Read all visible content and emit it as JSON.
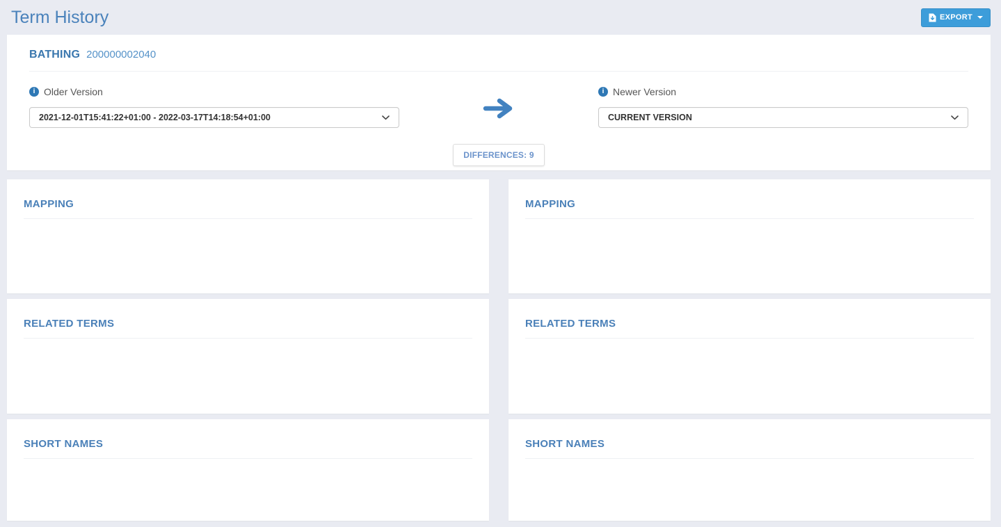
{
  "header": {
    "title": "Term History",
    "export_label": "EXPORT"
  },
  "term": {
    "name": "BATHING",
    "id": "200000002040"
  },
  "compare": {
    "older": {
      "label": "Older Version",
      "selected": "2021-12-01T15:41:22+01:00 - 2022-03-17T14:18:54+01:00"
    },
    "newer": {
      "label": "Newer Version",
      "selected": "CURRENT VERSION"
    },
    "differences": {
      "label": "DIFFERENCES: 9",
      "count": 9
    }
  },
  "panels": {
    "left": [
      "MAPPING",
      "RELATED TERMS",
      "SHORT NAMES"
    ],
    "right": [
      "MAPPING",
      "RELATED TERMS",
      "SHORT NAMES"
    ]
  },
  "icons": {
    "export_file": "file-download-icon",
    "info": "info-circle-icon",
    "arrow": "arrow-right-icon",
    "select_chevron": "chevron-down-icon",
    "caret": "caret-down-icon",
    "info_glyph": "i"
  },
  "colors": {
    "page_bg": "#e9ebf2",
    "accent_blue": "#4a80b8",
    "button_blue": "#3d9dda",
    "term_blue": "#3a77ae",
    "term_id_blue": "#5592c8",
    "info_blue": "#2e78b5",
    "arrow_blue": "#4282c0",
    "diff_text_blue": "#6b93cb",
    "label_gray": "#555555",
    "select_text": "#333333",
    "divider": "#eef0f4"
  }
}
